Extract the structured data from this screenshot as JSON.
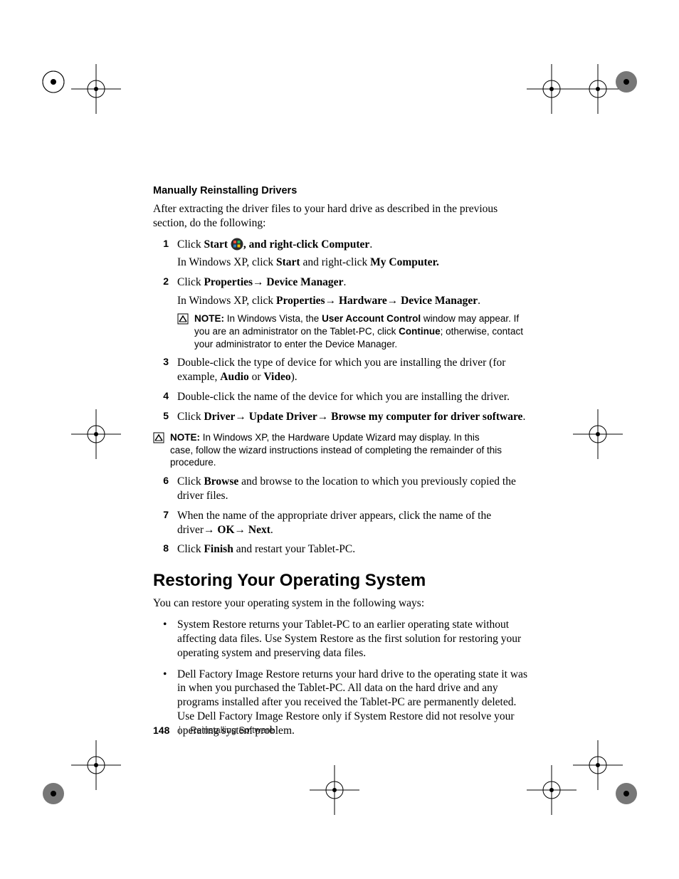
{
  "subheading": "Manually Reinstalling Drivers",
  "intro": "After extracting the driver files to your hard drive as described in the previous section, do the following:",
  "steps": {
    "s1": {
      "num": "1",
      "a": "Click ",
      "b_bold": "Start ",
      "c": ", and right-click ",
      "d_bold": "Computer",
      "e": ".",
      "sub_a": "In Windows XP, click ",
      "sub_b_bold": "Start",
      "sub_c": " and right-click ",
      "sub_d_bold": "My Computer."
    },
    "s2": {
      "num": "2",
      "a": "Click ",
      "b_bold": "Properties",
      "arrow1": "→ ",
      "c_bold": "Device Manager",
      "d": ".",
      "sub_a": "In Windows XP, click ",
      "sub_b_bold": "Properties",
      "sub_arrow1": "→ ",
      "sub_c_bold": "Hardware",
      "sub_arrow2": "→ ",
      "sub_d_bold": "Device Manager",
      "sub_e": "."
    },
    "note1": {
      "label": "NOTE:",
      "a": " In Windows Vista, the ",
      "b_bold": "User Account Control",
      "c": " window may appear. If you are an administrator on the Tablet-PC, click ",
      "d_bold": "Continue",
      "e": "; otherwise, contact your administrator to enter the Device Manager."
    },
    "s3": {
      "num": "3",
      "a": "Double-click the type of device for which you are installing the driver (for example, ",
      "b_bold": "Audio",
      "c": " or ",
      "d_bold": "Video",
      "e": ")."
    },
    "s4": {
      "num": "4",
      "text": "Double-click the name of the device for which you are installing the driver."
    },
    "s5": {
      "num": "5",
      "a": "Click ",
      "b_bold": "Driver",
      "arrow1": "→ ",
      "c_bold": "Update Driver",
      "arrow2": "→ ",
      "d_bold": "Browse my computer for driver software",
      "e": "."
    },
    "note2": {
      "label": "NOTE:",
      "text": " In Windows XP, the Hardware Update Wizard may display. In this case, follow the wizard instructions instead of completing the remainder of this procedure."
    },
    "s6": {
      "num": "6",
      "a": "Click ",
      "b_bold": "Browse",
      "c": " and browse to the location to which you previously copied the driver files."
    },
    "s7": {
      "num": "7",
      "a": "When the name of the appropriate driver appears, click the name of the driver",
      "arrow1": "→ ",
      "b_bold": "OK",
      "arrow2": "→ ",
      "c_bold": "Next",
      "d": "."
    },
    "s8": {
      "num": "8",
      "a": "Click ",
      "b_bold": "Finish",
      "c": " and restart your Tablet-PC."
    }
  },
  "section2": {
    "title": "Restoring Your Operating System",
    "intro": "You can restore your operating system in the following ways:",
    "b1": "System Restore returns your Tablet-PC to an earlier operating state without affecting data files. Use System Restore as the first solution for restoring your operating system and preserving data files.",
    "b2": "Dell Factory Image Restore returns your hard drive to the operating state it was in when you purchased the Tablet-PC. All data on the hard drive and any programs installed after you received the Tablet-PC are permanently deleted. Use Dell Factory Image Restore only if System Restore did not resolve your operating system problem."
  },
  "footer": {
    "page": "148",
    "section": "Reinstalling Software"
  }
}
